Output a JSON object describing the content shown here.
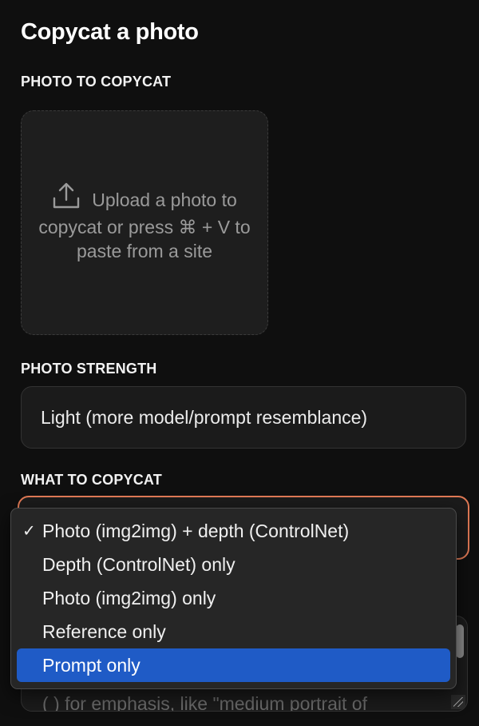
{
  "page": {
    "title": "Copycat a photo"
  },
  "photo_section": {
    "label": "PHOTO TO COPYCAT",
    "upload_text": "Upload a photo to copycat or press ⌘ + V to paste from a site",
    "upload_icon": "upload-icon"
  },
  "strength_section": {
    "label": "PHOTO STRENGTH",
    "selected_value": "Light (more model/prompt resemblance)"
  },
  "what_section": {
    "label": "WHAT TO COPYCAT",
    "accent_color": "#e07955",
    "options": [
      {
        "label": "Photo (img2img) + depth (ControlNet)",
        "checked": true
      },
      {
        "label": "Depth (ControlNet) only",
        "checked": false
      },
      {
        "label": "Photo (img2img) only",
        "checked": false
      },
      {
        "label": "Reference only",
        "checked": false
      },
      {
        "label": "Prompt only",
        "checked": false,
        "highlighted": true
      }
    ],
    "checkmark": "✓",
    "highlight_color": "#1f5bc6"
  },
  "prompt_section": {
    "placeholder_text": "( ) for emphasis, like \"medium portrait of"
  }
}
